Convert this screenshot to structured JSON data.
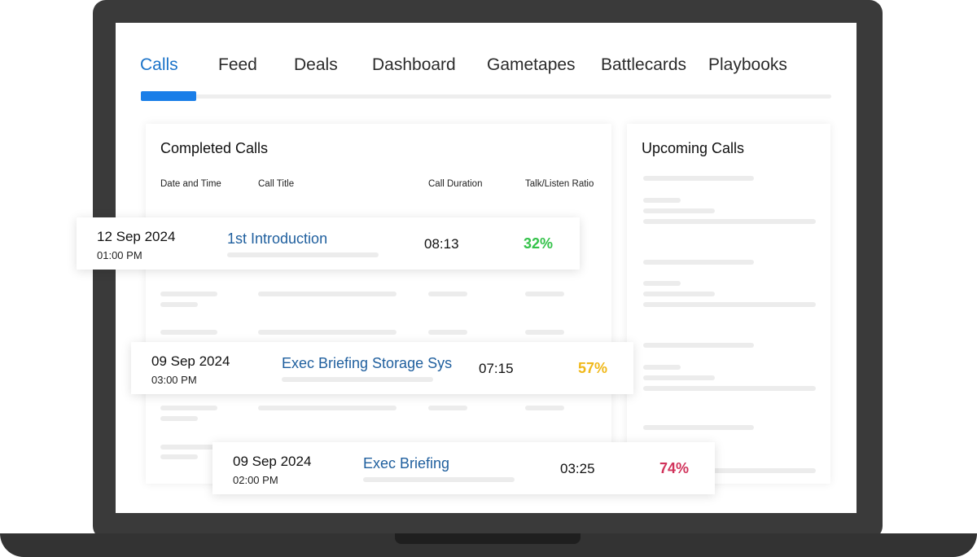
{
  "tabs": [
    {
      "label": "Calls",
      "active": true
    },
    {
      "label": "Feed",
      "active": false
    },
    {
      "label": "Deals",
      "active": false
    },
    {
      "label": "Dashboard",
      "active": false
    },
    {
      "label": "Gametapes",
      "active": false
    },
    {
      "label": "Battlecards",
      "active": false
    },
    {
      "label": "Playbooks",
      "active": false
    }
  ],
  "completed": {
    "title": "Completed Calls",
    "columns": [
      "Date and Time",
      "Call Title",
      "Call Duration",
      "Talk/Listen Ratio"
    ],
    "calls": [
      {
        "date": "12 Sep 2024",
        "time": "01:00 PM",
        "title": "1st Introduction",
        "duration": "08:13",
        "ratio": "32%",
        "ratio_color": "#34c24a"
      },
      {
        "date": "09 Sep 2024",
        "time": "03:00 PM",
        "title": "Exec Briefing Storage Sys",
        "duration": "07:15",
        "ratio": "57%",
        "ratio_color": "#f0b81a"
      },
      {
        "date": "09 Sep 2024",
        "time": "02:00 PM",
        "title": "Exec Briefing",
        "duration": "03:25",
        "ratio": "74%",
        "ratio_color": "#d1335b"
      }
    ]
  },
  "upcoming": {
    "title": "Upcoming Calls"
  },
  "colors": {
    "accent": "#1a73c9",
    "indicator": "#1a7ee8",
    "device": "#3a3a3a"
  }
}
